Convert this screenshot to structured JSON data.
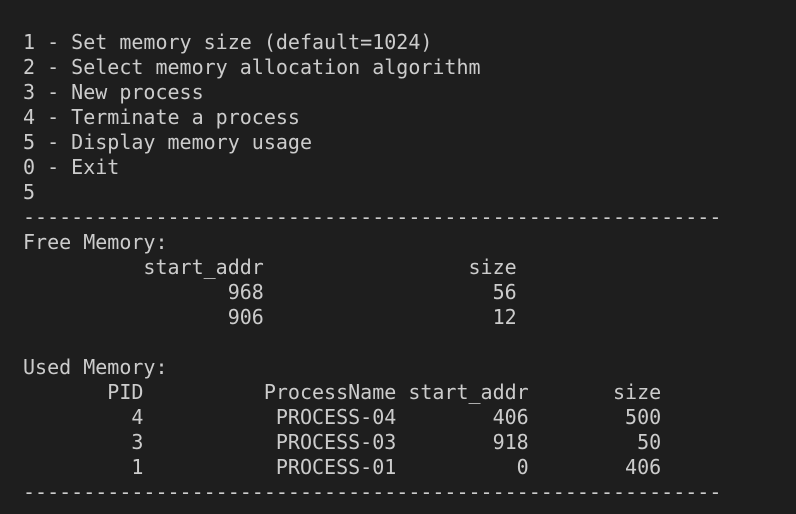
{
  "menu": {
    "items": [
      "1 - Set memory size (default=1024)",
      "2 - Select memory allocation algorithm",
      "3 - New process",
      "4 - Terminate a process",
      "5 - Display memory usage",
      "0 - Exit"
    ],
    "user_input": "5"
  },
  "separator": "----------------------------------------------------------",
  "free_memory": {
    "heading": "Free Memory:",
    "header_line": "          start_addr                 size",
    "rows": [
      "                 968                   56",
      "                 906                   12"
    ]
  },
  "used_memory": {
    "heading": "Used Memory:",
    "header_line": "       PID          ProcessName start_addr       size",
    "rows": [
      "         4           PROCESS-04        406        500",
      "         3           PROCESS-03        918         50",
      "         1           PROCESS-01          0        406"
    ]
  }
}
